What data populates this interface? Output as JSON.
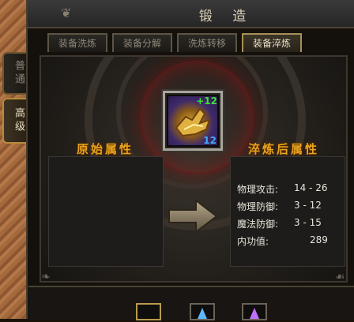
{
  "window": {
    "title": "锻 造"
  },
  "side_tabs": [
    {
      "label": "普通",
      "active": false
    },
    {
      "label": "高级",
      "active": true
    }
  ],
  "tabs": [
    {
      "label": "装备洗炼",
      "active": false
    },
    {
      "label": "装备分解",
      "active": false
    },
    {
      "label": "洗炼转移",
      "active": false
    },
    {
      "label": "装备淬炼",
      "active": true
    }
  ],
  "item": {
    "icon": "golden-glove-icon",
    "plus": "+12",
    "count": "12"
  },
  "original_panel": {
    "label": "原始属性"
  },
  "result_panel": {
    "label": "淬炼后属性",
    "stats": [
      {
        "name": "物理攻击:",
        "value": "14 - 26"
      },
      {
        "name": "物理防御:",
        "value": "3 - 12"
      },
      {
        "name": "魔法防御:",
        "value": "3 - 15"
      },
      {
        "name": "内功值:",
        "value": "289"
      }
    ]
  },
  "colors": {
    "label_orange": "#e8a31c",
    "plus_green": "#3ee03a",
    "count_blue": "#41a9ff"
  }
}
